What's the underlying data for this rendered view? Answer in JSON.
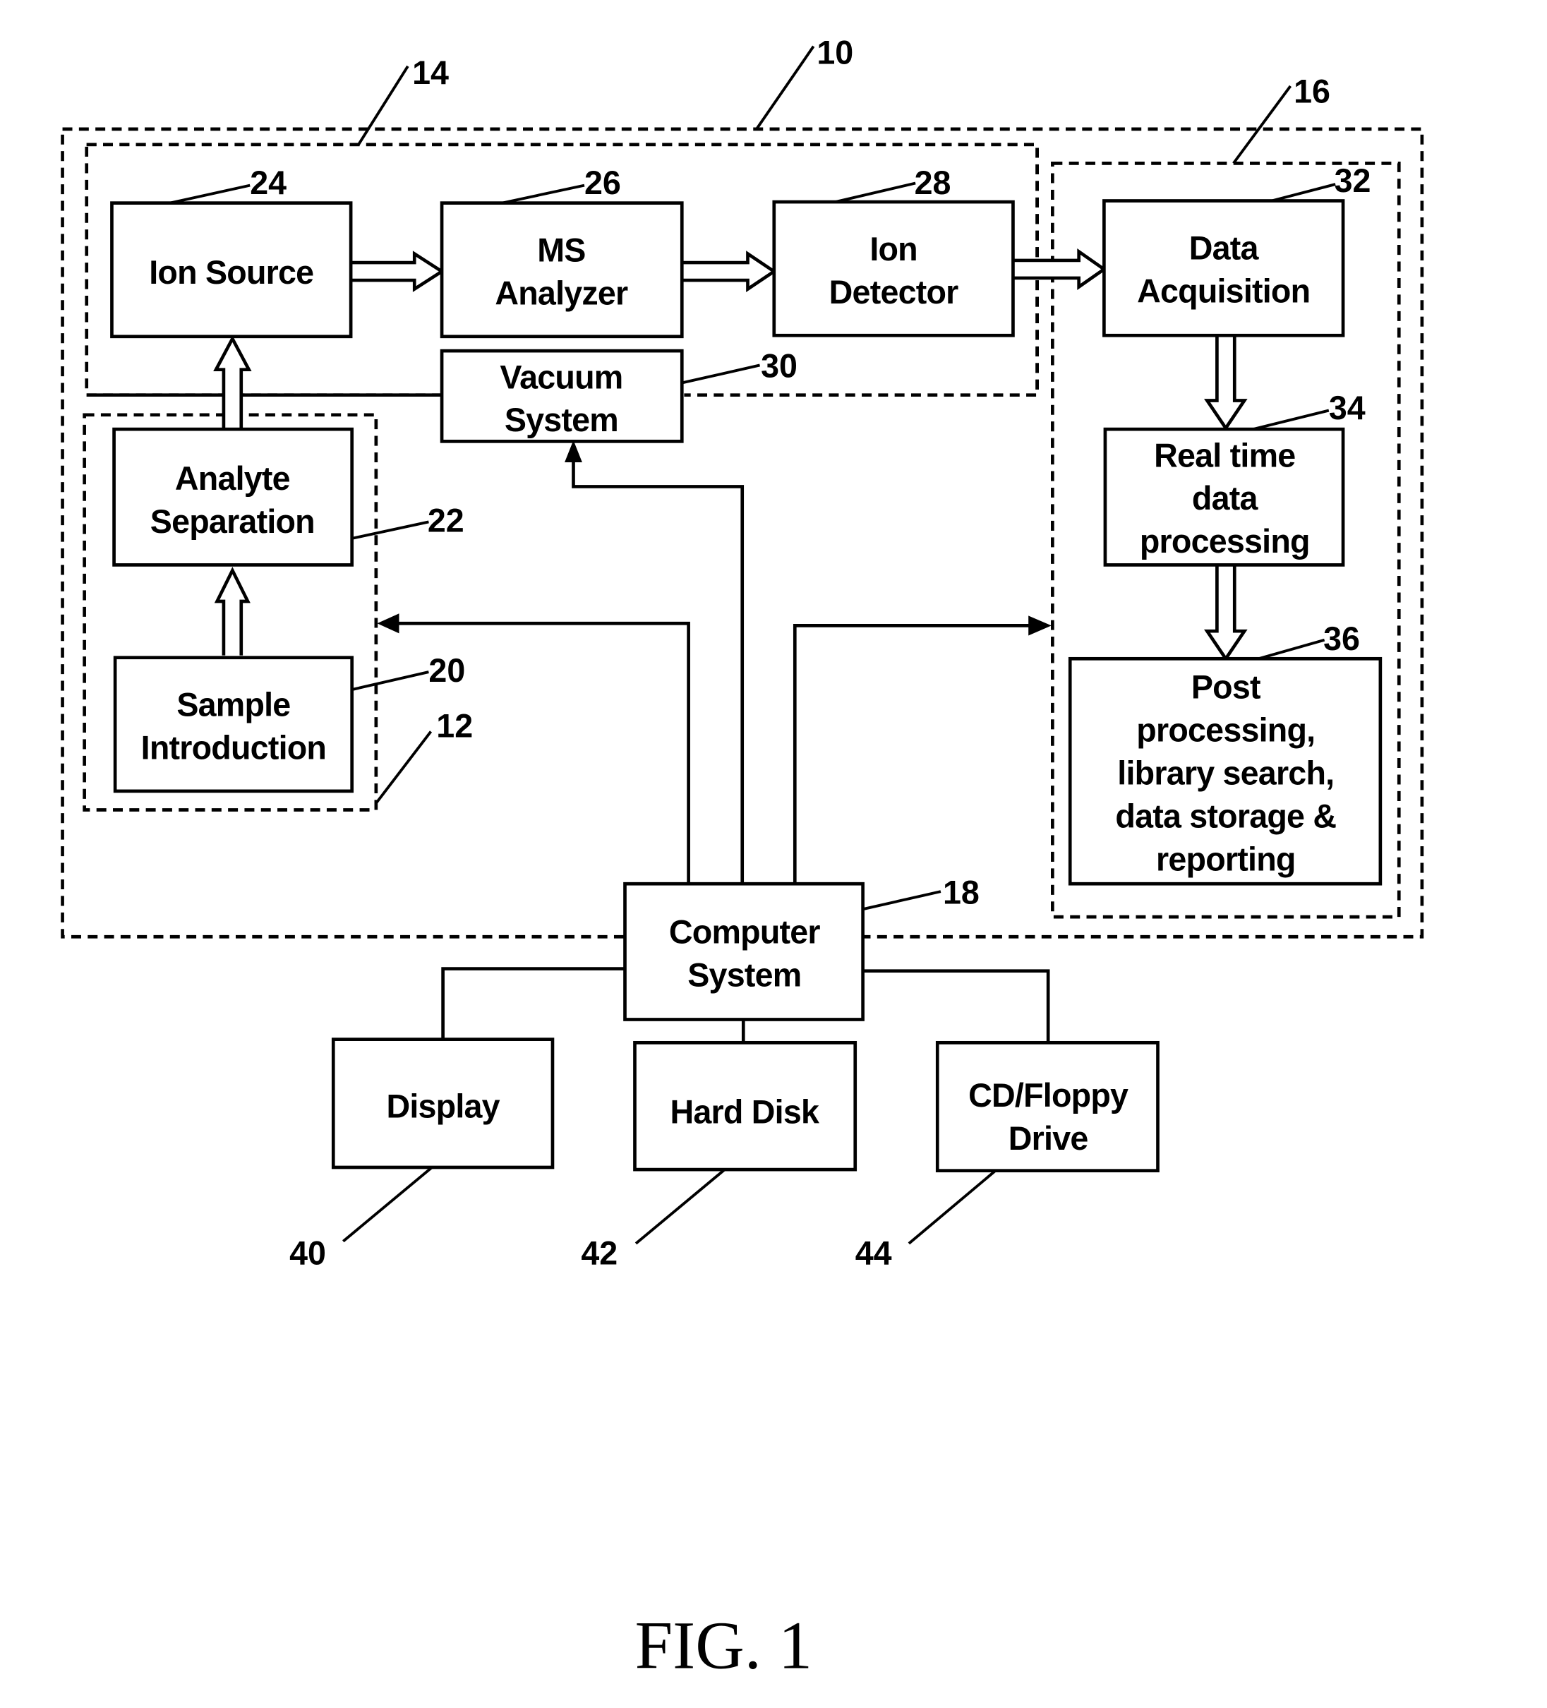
{
  "figure": {
    "title": "FIG. 1",
    "groups": {
      "system": {
        "ref": "10"
      },
      "sample_handling": {
        "ref": "12"
      },
      "mass_spectrometer": {
        "ref": "14"
      },
      "data_handling": {
        "ref": "16"
      }
    },
    "blocks": {
      "ion_source": {
        "ref": "24",
        "lines": [
          "Ion Source"
        ]
      },
      "ms_analyzer": {
        "ref": "26",
        "lines": [
          "MS",
          "Analyzer"
        ]
      },
      "ion_detector": {
        "ref": "28",
        "lines": [
          "Ion",
          "Detector"
        ]
      },
      "vacuum_system": {
        "ref": "30",
        "lines": [
          "Vacuum",
          "System"
        ]
      },
      "data_acquisition": {
        "ref": "32",
        "lines": [
          "Data",
          "Acquisition"
        ]
      },
      "real_time_processing": {
        "ref": "34",
        "lines": [
          "Real time",
          "data",
          "processing"
        ]
      },
      "post_processing": {
        "ref": "36",
        "lines": [
          "Post",
          "processing,",
          "library search,",
          "data storage &",
          "reporting"
        ]
      },
      "analyte_separation": {
        "ref": "22",
        "lines": [
          "Analyte",
          "Separation"
        ]
      },
      "sample_introduction": {
        "ref": "20",
        "lines": [
          "Sample",
          "Introduction"
        ]
      },
      "computer_system": {
        "ref": "18",
        "lines": [
          "Computer",
          "System"
        ]
      },
      "display": {
        "ref": "40",
        "lines": [
          "Display"
        ]
      },
      "hard_disk": {
        "ref": "42",
        "lines": [
          "Hard Disk"
        ]
      },
      "cd_floppy": {
        "ref": "44",
        "lines": [
          "CD/Floppy",
          "Drive"
        ]
      }
    },
    "flows": [
      {
        "from": "Sample Introduction",
        "to": "Analyte Separation",
        "style": "hollow-arrow"
      },
      {
        "from": "Analyte Separation",
        "to": "Ion Source",
        "style": "hollow-arrow"
      },
      {
        "from": "Ion Source",
        "to": "MS Analyzer",
        "style": "hollow-arrow"
      },
      {
        "from": "MS Analyzer",
        "to": "Ion Detector",
        "style": "hollow-arrow"
      },
      {
        "from": "Ion Detector",
        "to": "Data Acquisition",
        "style": "hollow-arrow"
      },
      {
        "from": "Data Acquisition",
        "to": "Real time data processing",
        "style": "hollow-arrow"
      },
      {
        "from": "Real time data processing",
        "to": "Post processing",
        "style": "hollow-arrow"
      },
      {
        "from": "Computer System",
        "to": "Vacuum System",
        "style": "solid-arrow"
      },
      {
        "from": "Computer System",
        "to": "Sample handling group (12)",
        "style": "solid-arrow"
      },
      {
        "from": "Computer System",
        "to": "Data handling group (16)",
        "style": "solid-arrow"
      },
      {
        "from": "Computer System",
        "to": "Display",
        "style": "line"
      },
      {
        "from": "Computer System",
        "to": "Hard Disk",
        "style": "line"
      },
      {
        "from": "Computer System",
        "to": "CD/Floppy Drive",
        "style": "line"
      }
    ]
  }
}
